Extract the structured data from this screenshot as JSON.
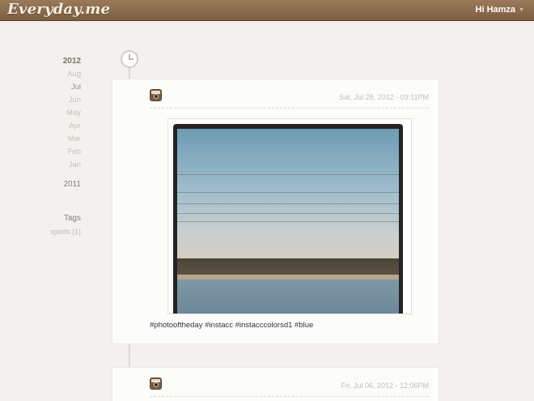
{
  "header": {
    "logo": "Everyday.me",
    "user_greeting": "Hi Hamza",
    "caret_icon": "caret-down-icon"
  },
  "sidebar": {
    "year_current": "2012",
    "months": [
      "Aug",
      "Jul",
      "Jun",
      "May",
      "Apr",
      "Mar",
      "Feb",
      "Jan"
    ],
    "active_month": "Jul",
    "year_other": "2011",
    "tags_title": "Tags",
    "tags": [
      "sports (1)"
    ]
  },
  "posts": [
    {
      "source_icon": "instagram-icon",
      "date": "Sat, Jul 28, 2012 - 03:11PM",
      "caption": "#photooftheday #instacc #instacccolorsd1 #blue"
    },
    {
      "source_icon": "instagram-icon",
      "date": "Fri, Jul 06, 2012 - 12:06PM"
    }
  ],
  "colors": {
    "header_bg": "#8a6a4b",
    "page_bg": "#f3f1ee",
    "card_bg": "#fcfcfb"
  }
}
